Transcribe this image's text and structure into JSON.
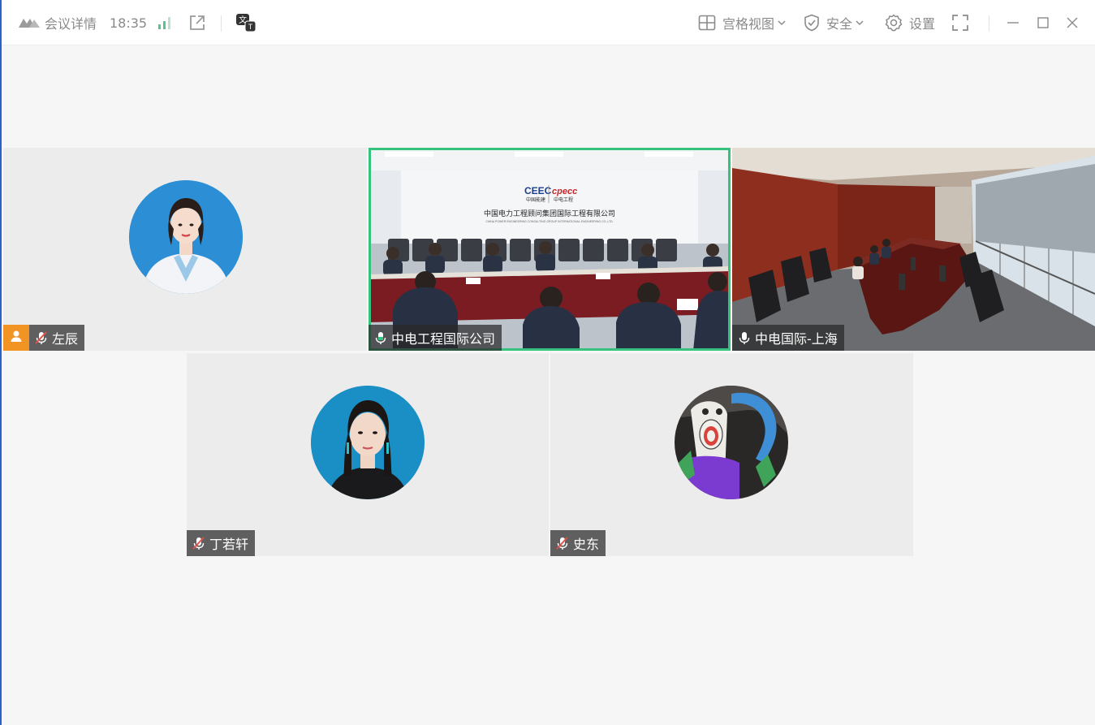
{
  "titlebar": {
    "meeting_details": "会议详情",
    "time": "18:35",
    "grid_view": "宫格视图",
    "security": "安全",
    "settings": "设置"
  },
  "participants": [
    {
      "name": "左辰",
      "muted": true,
      "host": true,
      "video": false
    },
    {
      "name": "中电工程国际公司",
      "muted": false,
      "active_speaker": true,
      "video": true
    },
    {
      "name": "中电国际-上海",
      "muted": false,
      "video": true
    },
    {
      "name": "丁若轩",
      "muted": true,
      "video": false
    },
    {
      "name": "史东",
      "muted": true,
      "video": false
    }
  ],
  "room1": {
    "logo_left": "CEEC",
    "logo_left_sub": "中国能建",
    "logo_right": "cpecc",
    "logo_right_sub": "中电工程",
    "banner": "中国电力工程顾问集团国际工程有限公司",
    "banner_en": "CHINA POWER ENGINEERING CONSULTING GROUP INTERNATIONAL ENGINEERING CO.,LTD."
  },
  "colors": {
    "accent_green": "#35c27c",
    "host_orange": "#f29423",
    "muted_red": "#e0504a"
  }
}
